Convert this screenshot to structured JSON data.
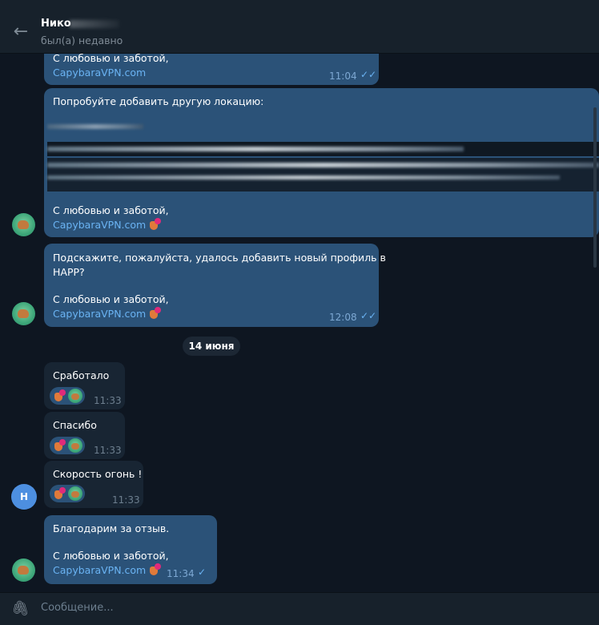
{
  "header": {
    "contact_name": "Нико",
    "status": "был(а) недавно"
  },
  "date_separator": "14 июня",
  "messages": [
    {
      "lines": [
        "С любовью и заботой,"
      ],
      "link": "CapybaraVPN.com",
      "time": "11:04"
    },
    {
      "lines": [
        "Попробуйте добавить другую локацию:"
      ],
      "closing": "С любовью и заботой,",
      "link": "CapybaraVPN.com"
    },
    {
      "lines": [
        "Подскажите, пожалуйста, удалось добавить новый профиль в",
        "HAPP?",
        "С любовью и заботой,"
      ],
      "link": "CapybaraVPN.com",
      "time": "12:08"
    },
    {
      "text": "Сработало",
      "time": "11:33"
    },
    {
      "text": "Спасибо",
      "time": "11:33"
    },
    {
      "text": "Скорость огонь !",
      "time": "11:33",
      "avatar_letter": "Н"
    },
    {
      "lines": [
        "Благодарим за отзыв.",
        "С любовью и заботой,"
      ],
      "link": "CapybaraVPN.com",
      "time": "11:34"
    }
  ],
  "composer": {
    "placeholder": "Сообщение..."
  },
  "icons": {
    "back": "arrow-left-icon",
    "attach": "paperclip-icon",
    "read": "double-check-icon",
    "sent": "check-icon"
  },
  "colors": {
    "outgoing_bubble": "#2b5278",
    "incoming_bubble": "#182533",
    "background": "#0e1621",
    "link": "#6ab3f3"
  }
}
